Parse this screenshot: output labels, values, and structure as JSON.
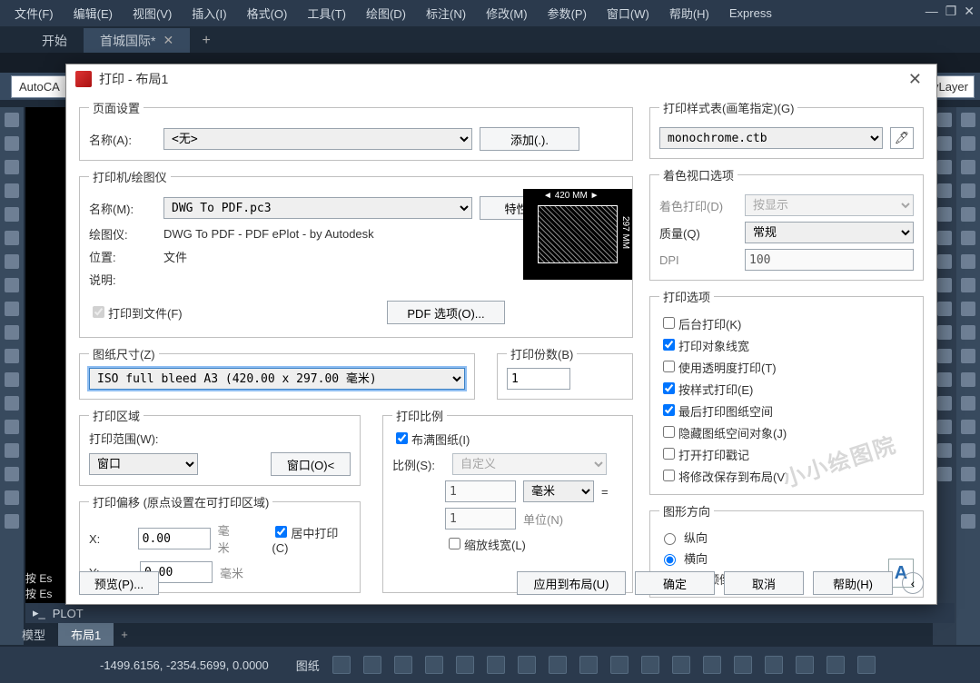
{
  "menubar": [
    "文件(F)",
    "编辑(E)",
    "视图(V)",
    "插入(I)",
    "格式(O)",
    "工具(T)",
    "绘图(D)",
    "标注(N)",
    "修改(M)",
    "参数(P)",
    "窗口(W)",
    "帮助(H)",
    "Express"
  ],
  "doctabs": {
    "start": "开始",
    "active": "首城国际*"
  },
  "ribbon": {
    "left": "AutoCA",
    "right": "ByLayer"
  },
  "cmdlines": [
    "按 Es",
    "按 Es"
  ],
  "plotbar": {
    "label": "PLOT"
  },
  "layouttabs": {
    "model": "模型",
    "layout": "布局1"
  },
  "status": {
    "coords": "-1499.6156, -2354.5699, 0.0000",
    "label": "图纸"
  },
  "dialog": {
    "title": "打印 - 布局1",
    "pageSetup": {
      "legend": "页面设置",
      "nameLbl": "名称(A):",
      "name": "<无>",
      "addBtn": "添加(.)."
    },
    "printer": {
      "legend": "打印机/绘图仪",
      "nameLbl": "名称(M):",
      "name": "DWG To PDF.pc3",
      "propBtn": "特性(R)...",
      "plotterLbl": "绘图仪:",
      "plotter": "DWG To PDF - PDF ePlot - by Autodesk",
      "locLbl": "位置:",
      "loc": "文件",
      "descLbl": "说明:",
      "toFile": "打印到文件(F)",
      "pdfBtn": "PDF 选项(O)...",
      "prevTop": "420 MM",
      "prevRight": "297 MM"
    },
    "paper": {
      "legend": "图纸尺寸(Z)",
      "value": "ISO full bleed A3 (420.00 x 297.00 毫米)"
    },
    "copies": {
      "legend": "打印份数(B)",
      "value": "1"
    },
    "area": {
      "legend": "打印区域",
      "rangeLbl": "打印范围(W):",
      "range": "窗口",
      "winBtn": "窗口(O)<"
    },
    "scale": {
      "legend": "打印比例",
      "fit": "布满图纸(I)",
      "scaleLbl": "比例(S):",
      "scaleVal": "自定义",
      "unitVal": "1",
      "unitSel": "毫米",
      "eq": "=",
      "drawVal": "1",
      "drawLbl": "单位(N)",
      "lw": "缩放线宽(L)"
    },
    "offset": {
      "legend": "打印偏移 (原点设置在可打印区域)",
      "xLbl": "X:",
      "xVal": "0.00",
      "xUnit": "毫米",
      "yLbl": "Y:",
      "yVal": "0.00",
      "yUnit": "毫米",
      "center": "居中打印(C)"
    },
    "styles": {
      "legend": "打印样式表(画笔指定)(G)",
      "value": "monochrome.ctb"
    },
    "shaded": {
      "legend": "着色视口选项",
      "shadeLbl": "着色打印(D)",
      "shadeVal": "按显示",
      "qLbl": "质量(Q)",
      "qVal": "常规",
      "dpiLbl": "DPI",
      "dpiVal": "100"
    },
    "options": {
      "legend": "打印选项",
      "items": [
        {
          "label": "后台打印(K)",
          "checked": false,
          "enabled": true
        },
        {
          "label": "打印对象线宽",
          "checked": true,
          "enabled": true
        },
        {
          "label": "使用透明度打印(T)",
          "checked": false,
          "enabled": true
        },
        {
          "label": "按样式打印(E)",
          "checked": true,
          "enabled": true
        },
        {
          "label": "最后打印图纸空间",
          "checked": true,
          "enabled": true
        },
        {
          "label": "隐藏图纸空间对象(J)",
          "checked": false,
          "enabled": true
        },
        {
          "label": "打开打印戳记",
          "checked": false,
          "enabled": true
        },
        {
          "label": "将修改保存到布局(V)",
          "checked": false,
          "enabled": true
        }
      ]
    },
    "orient": {
      "legend": "图形方向",
      "portrait": "纵向",
      "landscape": "横向",
      "upside": "上下颠倒打印(-)"
    },
    "footer": {
      "preview": "预览(P)...",
      "apply": "应用到布局(U)",
      "ok": "确定",
      "cancel": "取消",
      "help": "帮助(H)"
    },
    "watermark": "小小绘图院"
  }
}
